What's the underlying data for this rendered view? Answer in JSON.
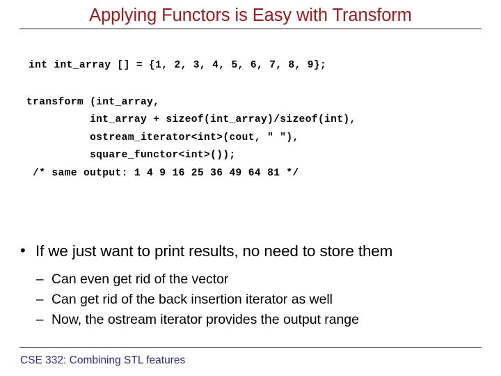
{
  "slide": {
    "title": "Applying Functors is Easy with Transform",
    "title_color": "#A01C1C",
    "background_color": "#FFFFFF",
    "rule_color": "#161616"
  },
  "code_block_1": {
    "language": "cpp",
    "text": "int int_array [] = {1, 2, 3, 4, 5, 6, 7, 8, 9};"
  },
  "code_block_2": {
    "language": "cpp",
    "text": "transform (int_array,\n          int_array + sizeof(int_array)/sizeof(int),\n          ostream_iterator<int>(cout, \" \"),\n          square_functor<int>());\n /* same output: 1 4 9 16 25 36 49 64 81 */"
  },
  "bullets": {
    "level1": {
      "marker": "•",
      "text": "If we just want to print results, no need to store them"
    },
    "level2": [
      {
        "marker": "–",
        "text": "Can even get rid of the vector"
      },
      {
        "marker": "–",
        "text": "Can get rid of the back insertion iterator as well"
      },
      {
        "marker": "–",
        "text": "Now, the ostream iterator provides the output range"
      }
    ]
  },
  "footer": {
    "text": "CSE 332: Combining STL features",
    "color": "#2B2B8C"
  }
}
